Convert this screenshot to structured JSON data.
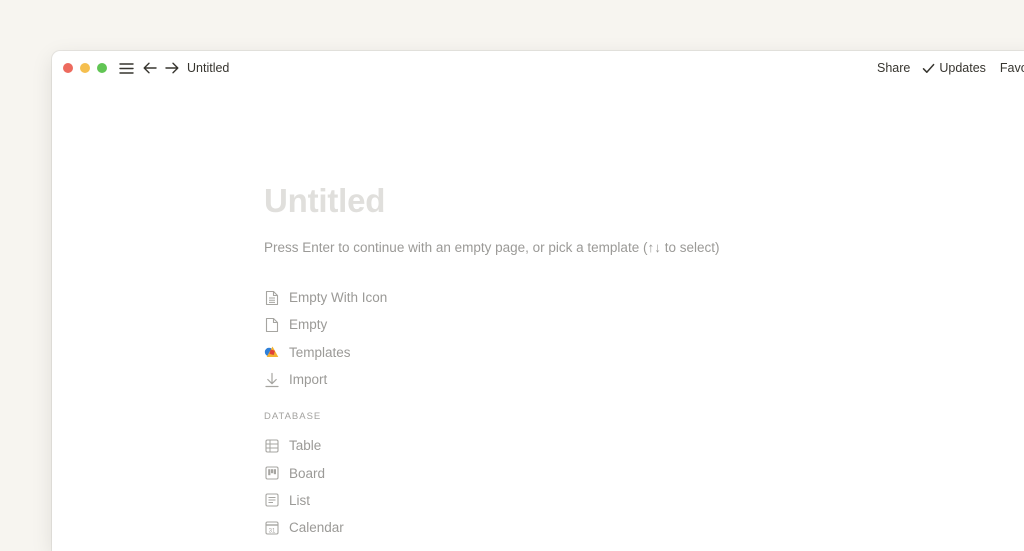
{
  "window": {
    "traffic_lights": {
      "close": "#ed6a5e",
      "minimize": "#f5bf4f",
      "zoom": "#61c554"
    },
    "breadcrumb": "Untitled",
    "actions": {
      "share": "Share",
      "updates": "Updates",
      "favorite": "Favorite"
    }
  },
  "page": {
    "title_placeholder": "Untitled",
    "hint": "Press Enter to continue with an empty page, or pick a template (↑↓ to select)",
    "options": [
      {
        "label": "Empty With Icon",
        "icon": "page-with-text-icon"
      },
      {
        "label": "Empty",
        "icon": "empty-page-icon"
      },
      {
        "label": "Templates",
        "icon": "templates-shapes-icon"
      },
      {
        "label": "Import",
        "icon": "download-arrow-icon"
      }
    ],
    "database_section": {
      "label": "DATABASE",
      "items": [
        {
          "label": "Table",
          "icon": "table-icon"
        },
        {
          "label": "Board",
          "icon": "board-icon"
        },
        {
          "label": "List",
          "icon": "list-icon"
        },
        {
          "label": "Calendar",
          "icon": "calendar-icon",
          "icon_text": "31"
        }
      ]
    }
  },
  "colors": {
    "background": "#f7f5f0",
    "text_primary": "#37352f",
    "text_muted": "#9b9a97",
    "title_placeholder": "#e0dfdc"
  }
}
